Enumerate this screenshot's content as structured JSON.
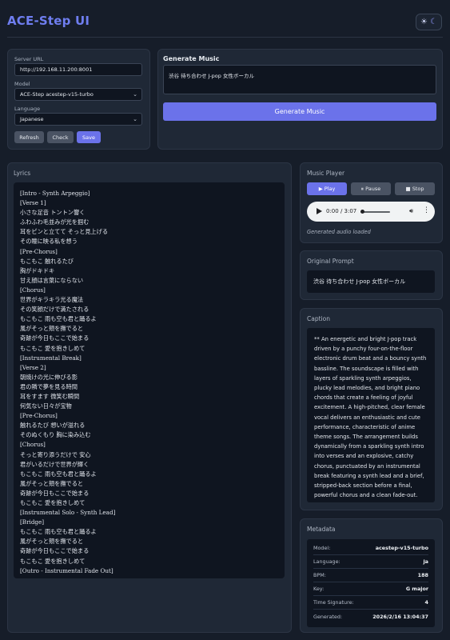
{
  "header": {
    "title": "ACE-Step UI",
    "theme_light_icon": "☀",
    "theme_dark_icon": "☾"
  },
  "settings": {
    "server_url_label": "Server URL",
    "server_url_value": "http://192.168.11.200:8001",
    "model_label": "Model",
    "model_value": "ACE-Step acestep-v15-turbo",
    "language_label": "Language",
    "language_value": "Japanese",
    "refresh_label": "Refresh",
    "check_label": "Check",
    "save_label": "Save"
  },
  "generate": {
    "title": "Generate Music",
    "prompt_value": "渋谷 待ち合わせ J-pop 女性ボーカル",
    "button_label": "Generate Music"
  },
  "lyrics": {
    "title": "Lyrics",
    "lines": [
      "[Intro - Synth Arpeggio]",
      "[Verse 1]",
      "小さな足音 トントン響く",
      "ふわふわ毛並みが光を掴む",
      "耳をピンと立てて そっと見上げる",
      "その瞳に映る私を想う",
      "[Pre-Chorus]",
      "もこもこ 触れるたび",
      "胸がドキドキ",
      "甘え顔は言葉にならない",
      "[Chorus]",
      "世界がキラキラ光る魔法",
      "その笑顔だけで満たされる",
      "もこもこ 雨も空も君と踊るよ",
      "風がそっと頬を撫でると",
      "奇跡が今日もここで始まる",
      "もこもこ 愛を抱きしめて",
      "[Instrumental Break]",
      "[Verse 2]",
      "朝焼けの光に伸びる影",
      "君の隣で夢を見る時間",
      "耳をすます 微笑む瞬間",
      "何気ない日々が宝物",
      "[Pre-Chorus]",
      "触れるたび 想いが溢れる",
      "そのぬくもり 胸に染み込む",
      "[Chorus]",
      "そっと寄り添うだけで 安心",
      "君がいるだけで世界が輝く",
      "もこもこ 雨も空も君と踊るよ",
      "風がそっと頬を撫でると",
      "奇跡が今日もここで始まる",
      "もこもこ 愛を抱きしめて",
      "[Instrumental Solo - Synth Lead]",
      "[Bridge]",
      "もこもこ 雨も空も君と踊るよ",
      "風がそっと頬を撫でると",
      "奇跡が今日もここで始まる",
      "もこもこ 愛を抱きしめて",
      "[Outro - Instrumental Fade Out]"
    ]
  },
  "player": {
    "title": "Music Player",
    "play_label": "▶ Play",
    "pause_label": "⏸ Pause",
    "stop_label": "■ Stop",
    "time": "0:00 / 3:07",
    "status": "Generated audio loaded",
    "progress": 0.0
  },
  "original_prompt": {
    "title": "Original Prompt",
    "value": "渋谷 待ち合わせ J-pop 女性ボーカル"
  },
  "caption": {
    "title": "Caption",
    "text": "** An energetic and bright J-pop track driven by a punchy four-on-the-floor electronic drum beat and a bouncy synth bassline. The soundscape is filled with layers of sparkling synth arpeggios, plucky lead melodies, and bright piano chords that create a feeling of joyful excitement. A high-pitched, clear female vocal delivers an enthusiastic and cute performance, characteristic of anime theme songs. The arrangement builds dynamically from a sparkling synth intro into verses and an explosive, catchy chorus, punctuated by an instrumental break featuring a synth lead and a brief, stripped-back section before a final, powerful chorus and a clean fade-out."
  },
  "metadata": {
    "title": "Metadata",
    "rows": [
      {
        "key": "Model:",
        "value": "acestep-v15-turbo"
      },
      {
        "key": "Language:",
        "value": "ja"
      },
      {
        "key": "BPM:",
        "value": "188"
      },
      {
        "key": "Key:",
        "value": "G major"
      },
      {
        "key": "Time Signature:",
        "value": "4"
      },
      {
        "key": "Generated:",
        "value": "2026/2/16 13:04:37"
      }
    ]
  },
  "colors": {
    "accent": "#6b72ea",
    "title": "#6f7ef0",
    "background": "#161d29",
    "card": "#1f2836"
  }
}
